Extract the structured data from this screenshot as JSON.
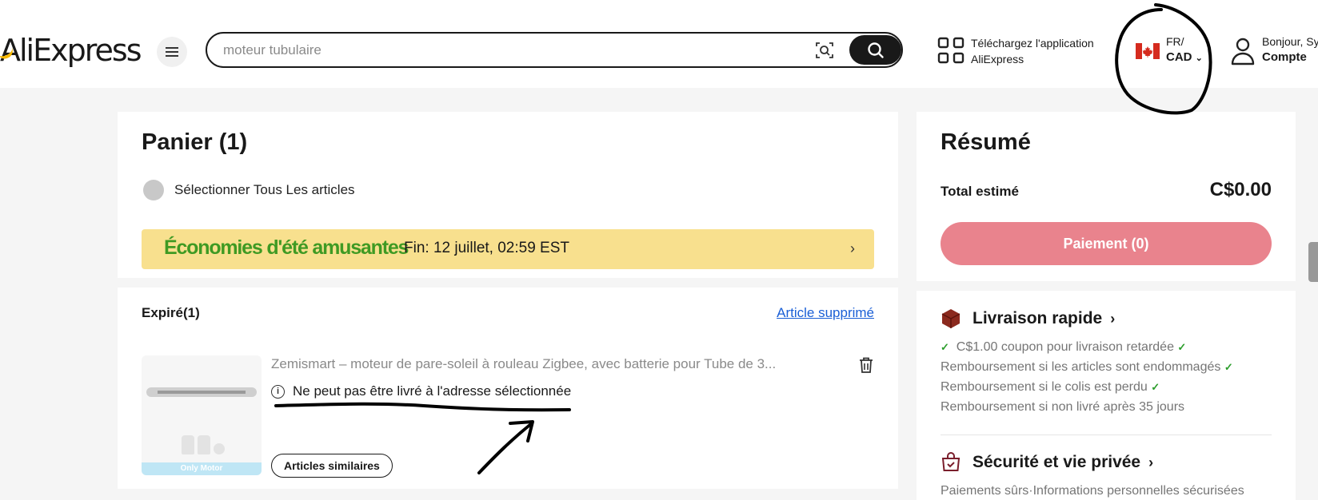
{
  "header": {
    "logo_text": "AliExpress",
    "search_placeholder": "moteur tubulaire",
    "app_line1": "Téléchargez l'application",
    "app_line2": "AliExpress",
    "locale_lang": "FR/",
    "locale_currency": "CAD",
    "greeting": "Bonjour, Sy",
    "account_label": "Compte"
  },
  "cart": {
    "title": "Panier (1)",
    "select_all_label": "Sélectionner Tous Les articles",
    "promo_brand": "Économies d'été amusantes",
    "promo_end": "Fin: 12 juillet, 02:59 EST"
  },
  "expired": {
    "title": "Expiré(1)",
    "removed_link": "Article supprimé",
    "item_title": "Zemismart – moteur de pare-soleil à rouleau Zigbee, avec batterie pour Tube de 3...",
    "thumb_caption": "Only Motor",
    "warning": "Ne peut pas être livré à l'adresse sélectionnée",
    "similar_button": "Articles similaires"
  },
  "summary": {
    "title": "Résumé",
    "total_label": "Total estimé",
    "total_value": "C$0.00",
    "pay_button": "Paiement (0)"
  },
  "delivery": {
    "title": "Livraison rapide",
    "lines": [
      "C$1.00 coupon pour livraison retardée",
      "Remboursement si les articles sont endommagés",
      "Remboursement si le colis est perdu",
      "Remboursement si non livré après 35 jours"
    ]
  },
  "security": {
    "title": "Sécurité et vie privée",
    "line": "Paiements sûrs·Informations personnelles sécurisées"
  },
  "colors": {
    "accent_pay": "#e9838d",
    "promo_bg": "#f8e08e",
    "promo_brand": "#3f9a23",
    "link": "#1a5fd6"
  }
}
